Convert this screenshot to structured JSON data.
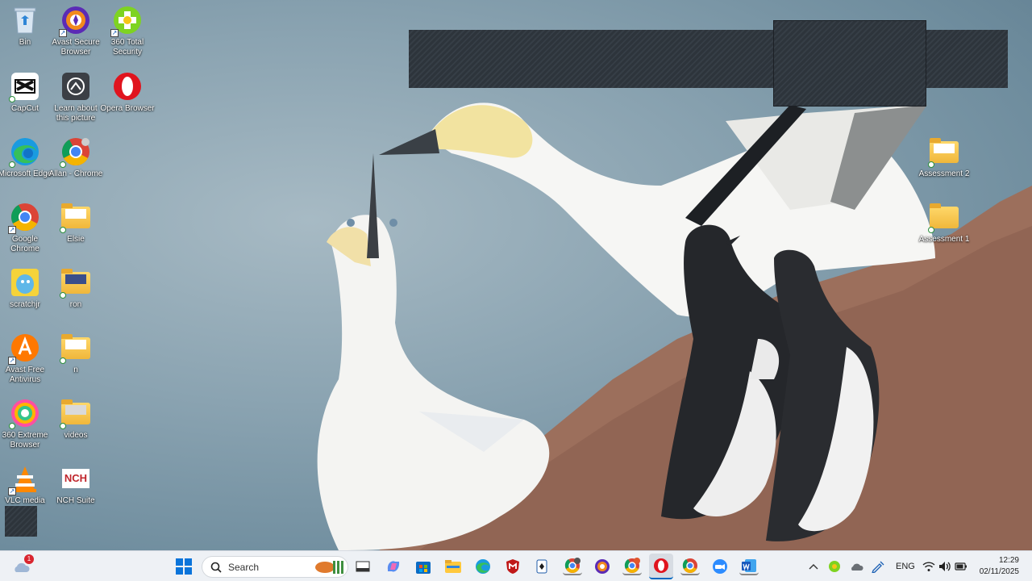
{
  "desktop_icons": [
    {
      "label": "Bin",
      "icon": "recycle-bin-icon"
    },
    {
      "label": "Avast Secure Browser",
      "icon": "avast-secure-browser-icon"
    },
    {
      "label": "360 Total Security",
      "icon": "360-total-security-icon"
    },
    {
      "label": "CapCut",
      "icon": "capcut-icon"
    },
    {
      "label": "Learn about this picture",
      "icon": "learn-picture-icon"
    },
    {
      "label": "Opera Browser",
      "icon": "opera-icon"
    },
    {
      "label": "Microsoft Edge",
      "icon": "edge-icon"
    },
    {
      "label": "Allan - Chrome",
      "icon": "chrome-profile-icon"
    },
    {
      "label": "Google Chrome",
      "icon": "chrome-icon"
    },
    {
      "label": "Elsie",
      "icon": "folder-icon"
    },
    {
      "label": "scratchjr",
      "icon": "scratchjr-icon"
    },
    {
      "label": "ron",
      "icon": "folder-icon"
    },
    {
      "label": "Avast Free Antivirus",
      "icon": "avast-antivirus-icon"
    },
    {
      "label": "n",
      "icon": "folder-icon"
    },
    {
      "label": "360 Extreme Browser",
      "icon": "360-extreme-browser-icon"
    },
    {
      "label": "videos",
      "icon": "folder-icon"
    },
    {
      "label": "VLC media",
      "icon": "vlc-icon"
    },
    {
      "label": "NCH Suite",
      "icon": "nch-suite-icon"
    },
    {
      "label": "Assessment 2",
      "icon": "folder-icon"
    },
    {
      "label": "Assessment 1",
      "icon": "folder-icon"
    }
  ],
  "taskbar": {
    "weather_badge": "1",
    "search_label": "Search",
    "apps": [
      "start-icon",
      "search-icon",
      "widgets-icon",
      "task-view-icon",
      "copilot-icon",
      "store-icon",
      "file-explorer-icon",
      "edge-icon",
      "mcafee-icon",
      "solitaire-icon",
      "chrome-profile-h-icon",
      "avast-browser-icon",
      "chrome-profile-r-icon",
      "opera-icon",
      "chrome-icon",
      "zoom-icon",
      "word-icon"
    ],
    "language": "ENG",
    "time": "12:29",
    "date": "02/11/2025"
  },
  "colors": {
    "accent": "#0067c0",
    "taskbar_bg": "#eef1f5"
  }
}
